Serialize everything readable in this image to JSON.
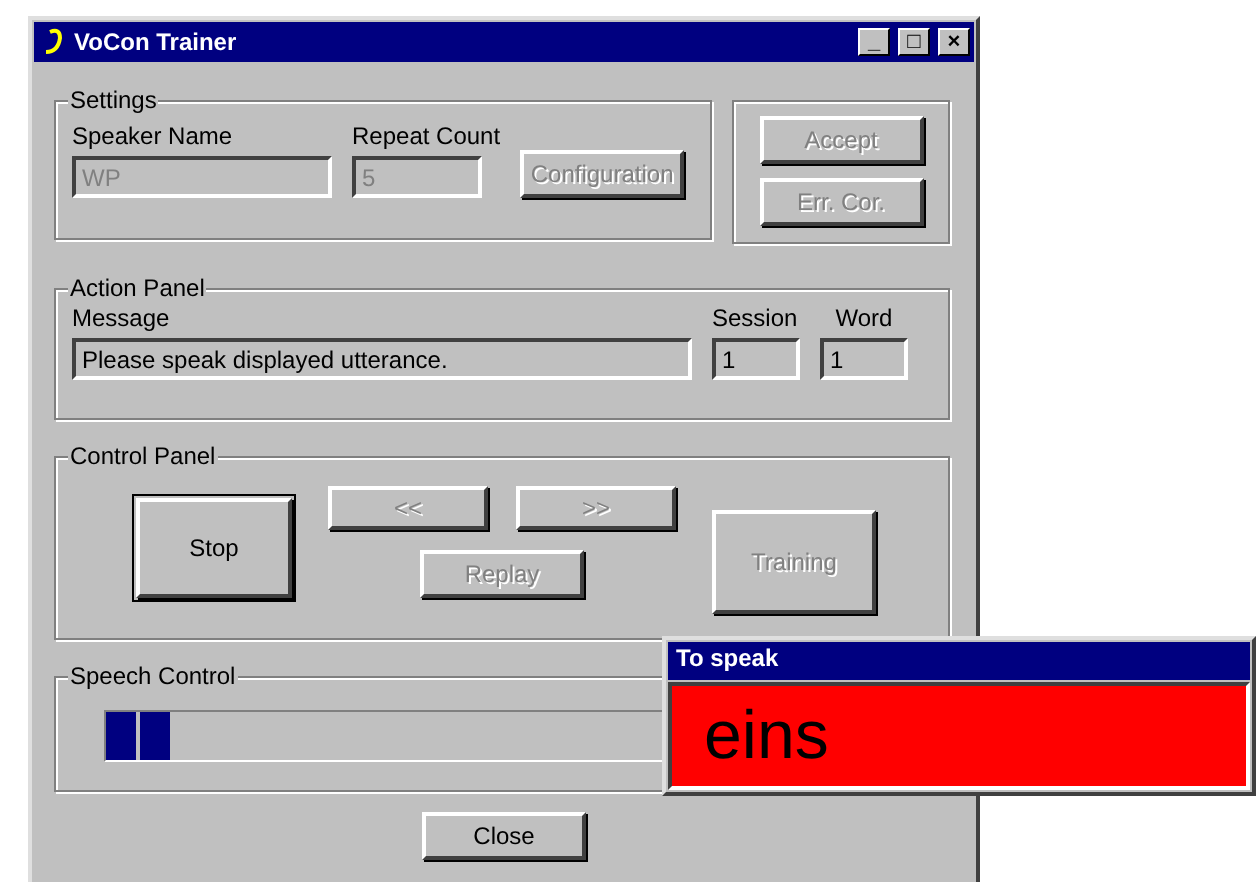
{
  "window": {
    "title": "VoCon Trainer",
    "controls": [
      "_",
      "□",
      "×"
    ]
  },
  "settings": {
    "title": "Settings",
    "speaker_name": {
      "label": "Speaker Name",
      "value": "WP",
      "disabled": true
    },
    "repeat_count": {
      "label": "Repeat Count",
      "value": "5",
      "disabled": true
    },
    "configuration": {
      "label": "Configuration",
      "disabled": true
    }
  },
  "side_buttons": [
    {
      "label": "Accept",
      "disabled": true
    },
    {
      "label": "Err. Cor.",
      "disabled": true
    }
  ],
  "action_panel": {
    "title": "Action Panel",
    "message": {
      "label": "Message",
      "value": "Please speak displayed utterance."
    },
    "session": {
      "label": "Session",
      "value": "1"
    },
    "word": {
      "label": "Word",
      "value": "1"
    }
  },
  "control_panel": {
    "title": "Control Panel",
    "stop": {
      "label": "Stop",
      "disabled": false
    },
    "prev": {
      "label": "<<",
      "disabled": true
    },
    "next": {
      "label": ">>",
      "disabled": true
    },
    "replay": {
      "label": "Replay",
      "disabled": true
    },
    "training": {
      "label": "Training",
      "disabled": true
    }
  },
  "speech_control": {
    "title": "Speech Control",
    "level": 0.08
  },
  "close": {
    "label": "Close",
    "disabled": false
  },
  "to_speak": {
    "title": "To speak",
    "word": "eins"
  }
}
